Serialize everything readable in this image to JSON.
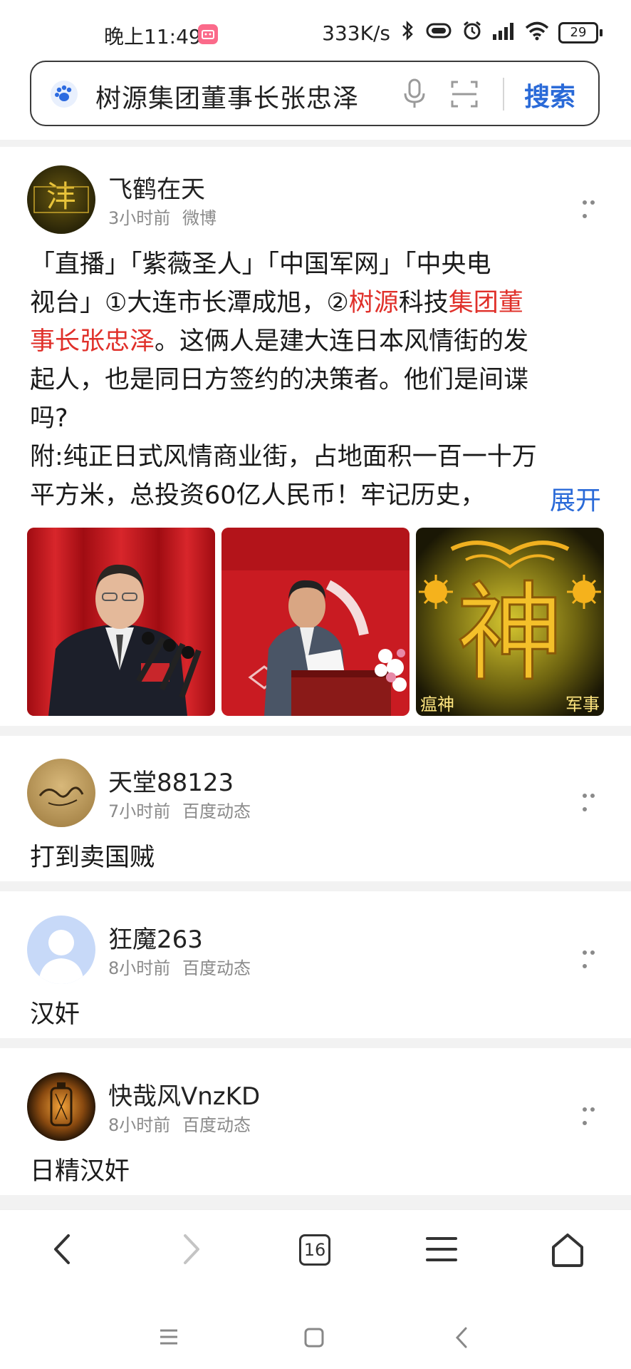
{
  "status_bar": {
    "time": "晚上11:49",
    "network_speed": "333K/s",
    "battery": "29"
  },
  "search": {
    "query": "树源集团董事长张忠泽",
    "button_label": "搜索"
  },
  "posts": [
    {
      "username": "飞鹤在天",
      "time": "3小时前",
      "source": "微博",
      "text": {
        "p1": "「直播」「紫薇圣人」「中国军网」「中央电",
        "p2": "视台」①大连市长潭成旭，②",
        "p2_red1": "树源",
        "p2_mid": "科技",
        "p2_red2": "集团董",
        "p3_red": "事长张忠泽",
        "p3": "。这俩人是建大连日本风情街的发",
        "p4": "起人，也是同日方签约的决策者。他们是间谍",
        "p5": "吗?",
        "p6": "附:纯正日式风情商业街，占地面积一百一十万",
        "p7": "平方米，总投资60亿人民币！牢记历史，"
      },
      "expand_label": "展开",
      "image3_caption_left": "瘟神",
      "image3_caption_right": "军事",
      "image3_char": "神"
    },
    {
      "username": "天堂88123",
      "time": "7小时前",
      "source": "百度动态",
      "content": "打到卖国贼"
    },
    {
      "username": "狂魔263",
      "time": "8小时前",
      "source": "百度动态",
      "content": "汉奸"
    },
    {
      "username": "快哉风VnzKD",
      "time": "8小时前",
      "source": "百度动态",
      "content": "日精汉奸"
    }
  ],
  "bottom_nav": {
    "tab_count": "16"
  },
  "colors": {
    "accent": "#2a6ad8",
    "highlight": "#e0302a"
  }
}
